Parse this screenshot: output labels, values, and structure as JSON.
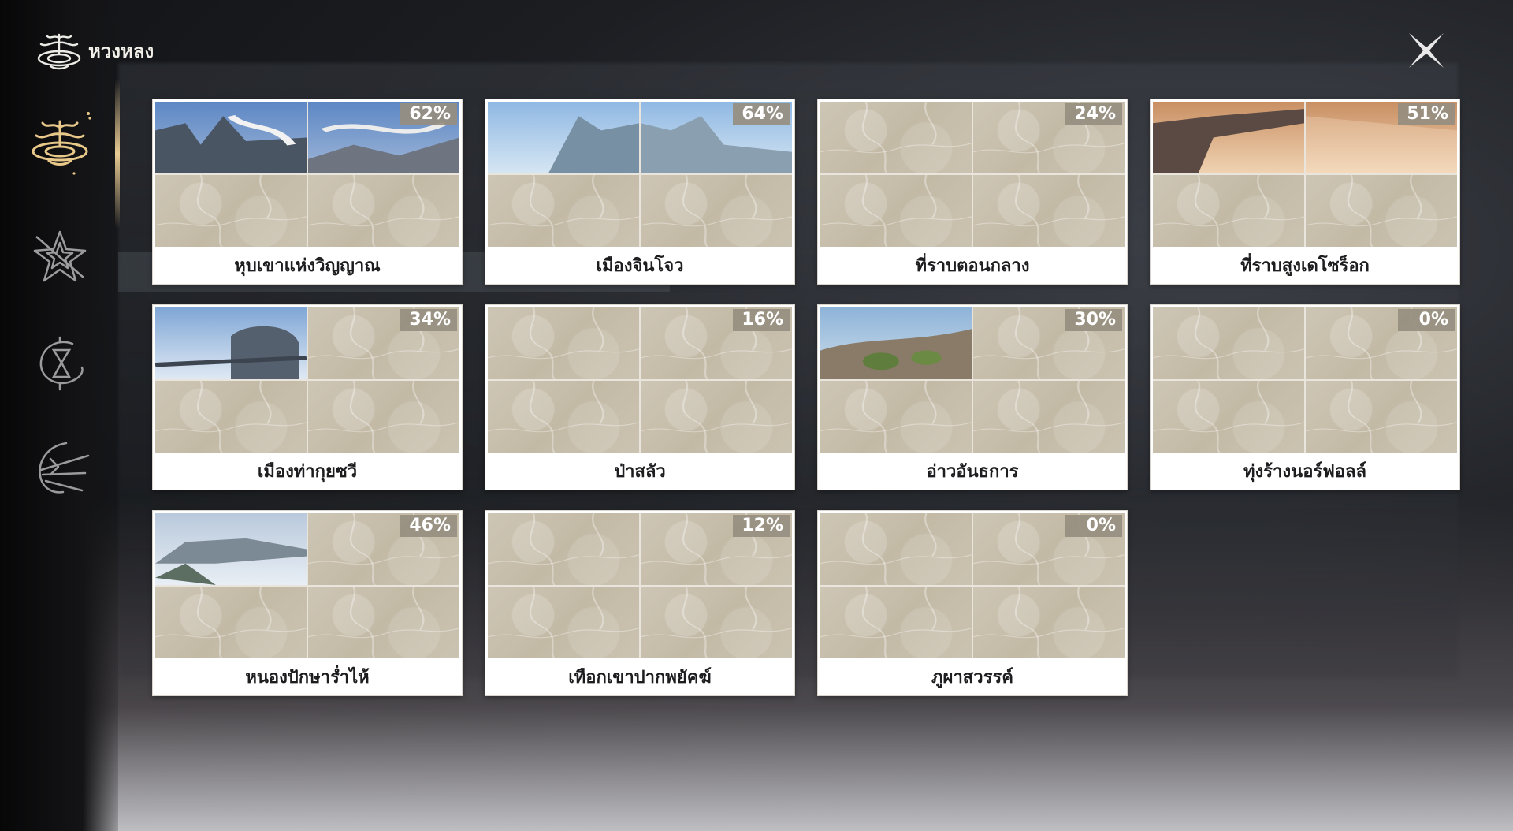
{
  "header": {
    "title": "หวงหลง"
  },
  "sidebar": {
    "items": [
      {
        "icon": "huanglong-emblem-icon",
        "active": true
      },
      {
        "icon": "star-crest-icon",
        "active": false
      },
      {
        "icon": "hourglass-crest-icon",
        "active": false
      },
      {
        "icon": "blade-crest-icon",
        "active": false
      }
    ]
  },
  "regions": [
    {
      "name": "หุบเขาแห่งวิญญาณ",
      "percent": "62%",
      "explored": 2,
      "scene": "dragon"
    },
    {
      "name": "เมืองจินโจว",
      "percent": "64%",
      "explored": 2,
      "scene": "city"
    },
    {
      "name": "ที่ราบตอนกลาง",
      "percent": "24%",
      "explored": 0,
      "scene": "none"
    },
    {
      "name": "ที่ราบสูงเดโซร็อก",
      "percent": "51%",
      "explored": 2,
      "scene": "sunset"
    },
    {
      "name": "เมืองท่ากุยซวี",
      "percent": "34%",
      "explored": 1,
      "scene": "port"
    },
    {
      "name": "ป่าสลัว",
      "percent": "16%",
      "explored": 0,
      "scene": "none"
    },
    {
      "name": "อ่าวอันธการ",
      "percent": "30%",
      "explored": 1,
      "scene": "bay"
    },
    {
      "name": "ทุ่งร้างนอร์ฟอลล์",
      "percent": "0%",
      "explored": 0,
      "scene": "none"
    },
    {
      "name": "หนองปักษาร่ำไห้",
      "percent": "46%",
      "explored": 1,
      "scene": "cliff"
    },
    {
      "name": "เทือกเขาปากพยัคฆ์",
      "percent": "12%",
      "explored": 0,
      "scene": "none"
    },
    {
      "name": "ภูผาสวรรค์",
      "percent": "0%",
      "explored": 0,
      "scene": "none"
    }
  ],
  "colors": {
    "card_bg": "#ffffff",
    "map_tile": "#c9c1ae",
    "badge_bg": "#968e80",
    "label_text": "#1d1d1f"
  }
}
